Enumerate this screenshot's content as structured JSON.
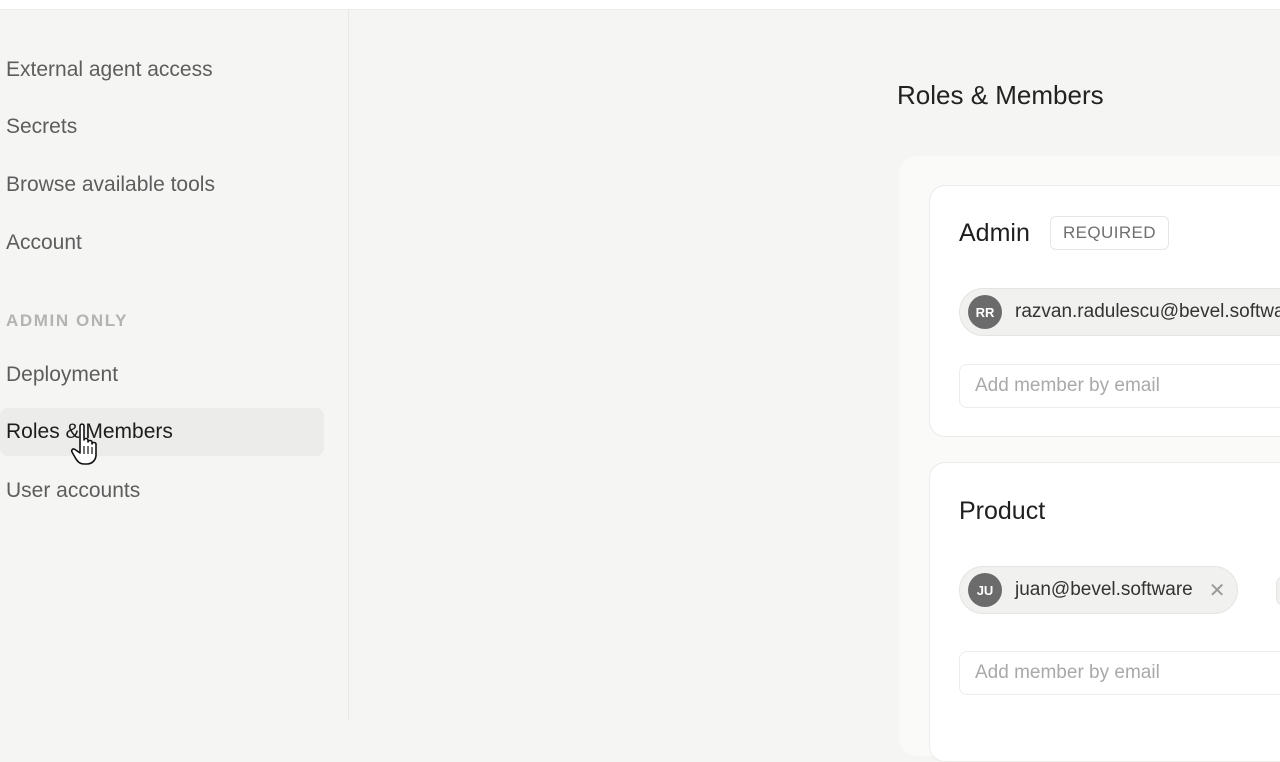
{
  "sidebar": {
    "items": [
      {
        "label": "External agent access"
      },
      {
        "label": "Secrets"
      },
      {
        "label": "Browse available tools"
      },
      {
        "label": "Account"
      }
    ],
    "admin_section_label": "ADMIN ONLY",
    "admin_items": [
      {
        "label": "Deployment"
      },
      {
        "label": "Roles & Members",
        "active": true
      },
      {
        "label": "User accounts"
      }
    ]
  },
  "main": {
    "title": "Roles & Members",
    "roles": [
      {
        "name": "Admin",
        "badge": "REQUIRED",
        "members": [
          {
            "initials": "RR",
            "email": "razvan.radulescu@bevel.software"
          }
        ],
        "add_placeholder": "Add member by email"
      },
      {
        "name": "Product",
        "members": [
          {
            "initials": "JU",
            "email": "juan@bevel.software",
            "remove_glyph": "✕"
          }
        ],
        "add_placeholder": "Add member by email"
      }
    ]
  },
  "icons": {
    "cursor": "hand-pointer-icon",
    "remove": "close-icon"
  },
  "colors": {
    "background": "#f5f5f4",
    "card": "#ffffff",
    "avatar": "#6b6b6b",
    "active_nav": "#ececea"
  }
}
